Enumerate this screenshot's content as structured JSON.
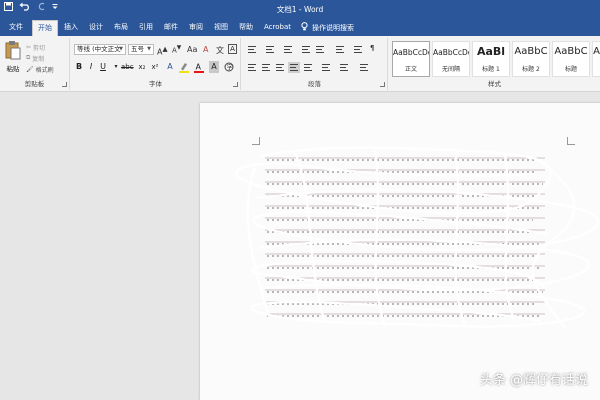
{
  "window": {
    "title": "文档1 - Word"
  },
  "tabs": [
    "文件",
    "开始",
    "插入",
    "设计",
    "布局",
    "引用",
    "邮件",
    "审阅",
    "视图",
    "帮助",
    "Acrobat"
  ],
  "active_tab": "开始",
  "tell_me": "操作说明搜索",
  "clipboard": {
    "paste": "粘贴",
    "cut": "剪切",
    "copy": "复制",
    "format_painter": "格式刷",
    "group_label": "剪贴板"
  },
  "font": {
    "name": "等线 (中文正文",
    "size": "五号",
    "group_label": "字体",
    "bold": "B",
    "italic": "I",
    "underline": "U"
  },
  "paragraph": {
    "group_label": "段落"
  },
  "styles": {
    "group_label": "样式",
    "items": [
      {
        "preview": "AaBbCcDc",
        "name": "正文"
      },
      {
        "preview": "AaBbCcDc",
        "name": "无间隔"
      },
      {
        "preview": "AaBl",
        "name": "标题 1"
      },
      {
        "preview": "AaBbC",
        "name": "标题 2"
      },
      {
        "preview": "AaBbC",
        "name": "标题"
      },
      {
        "preview": "A",
        "name": ""
      }
    ]
  },
  "watermark": "头条 @辉仔有话说",
  "colors": {
    "brand": "#2b579a",
    "ribbon": "#f3f3f3",
    "canvas": "#e6e6e6"
  }
}
